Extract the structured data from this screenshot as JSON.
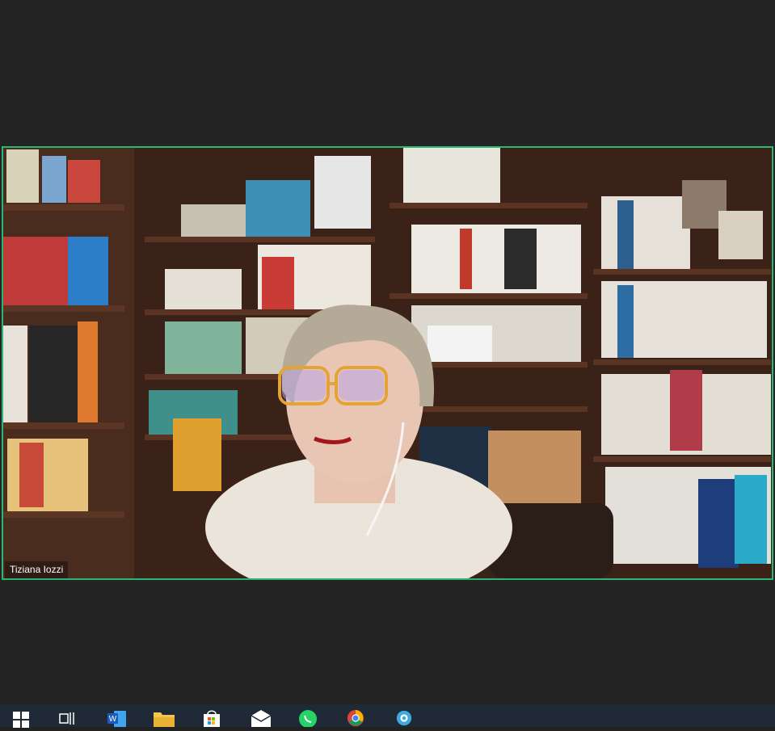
{
  "participant": {
    "name": "Tiziana Iozzi"
  },
  "colors": {
    "active_speaker_border": "#2bb673",
    "background": "#222222",
    "taskbar": "#1f2a36"
  },
  "taskbar": {
    "icons": [
      "windows-start-icon",
      "task-view-icon",
      "word-icon",
      "file-explorer-icon",
      "store-icon",
      "mail-icon",
      "whatsapp-icon",
      "chrome-icon",
      "app-icon"
    ]
  }
}
